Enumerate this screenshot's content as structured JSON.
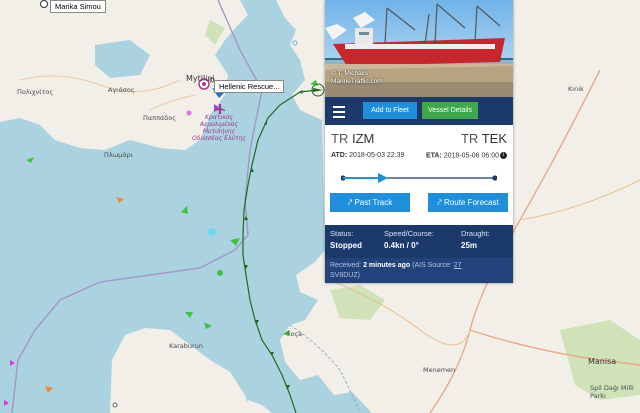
{
  "map": {
    "places": {
      "polichnitos": "Πολιχνίτος",
      "agiasos": "Αγιάσος",
      "plomari": "Πλωμάρι",
      "pappados": "Παππάδος",
      "mytilini": "Mytilini",
      "airport": "Κρατικός Αερολιμένας Μυτιλήνης Οδυσσέας Ελύτης",
      "karaburun": "Karaburun",
      "foca": "Foça",
      "kinik": "Kınık",
      "menemen": "Menemen",
      "manisa": "Manisa",
      "spil": "Spil Dağı Milli Parkı"
    },
    "vessel_tags": {
      "marika": "Marika Simou",
      "rescue": "Hellenic Rescue..."
    }
  },
  "vessel": {
    "photo_credit_line1": "© T. Michalis",
    "photo_credit_line2": "MarineTraffic.com",
    "add_to_fleet": "Add to Fleet",
    "vessel_details": "Vessel Details",
    "from_cc": "TR",
    "from_port": "IZM",
    "to_cc": "TR",
    "to_port": "TEK",
    "atd_label": "ATD:",
    "atd_value": "2018-05-03 22:39",
    "eta_label": "ETA:",
    "eta_value": "2018-05-06 06:00",
    "progress": 0.25,
    "past_track": "Past Track",
    "route_forecast": "Route Forecast",
    "status_label": "Status:",
    "status_value": "Stopped",
    "speed_label": "Speed/Course:",
    "speed_value": "0.4kn / 0°",
    "draught_label": "Draught:",
    "draught_value": "25m",
    "received_label": "Received:",
    "received_value": "2 minutes ago",
    "ais_prefix": "(AIS Source:",
    "ais_link": "27",
    "ais_code": "SV8DUZ)"
  },
  "colors": {
    "sea": "#aad3df",
    "land": "#f2efe9",
    "navy": "#1b3a6b",
    "blue_btn": "#1f8fdb",
    "green_btn": "#3ea84b",
    "track": "#1f6b1f"
  }
}
